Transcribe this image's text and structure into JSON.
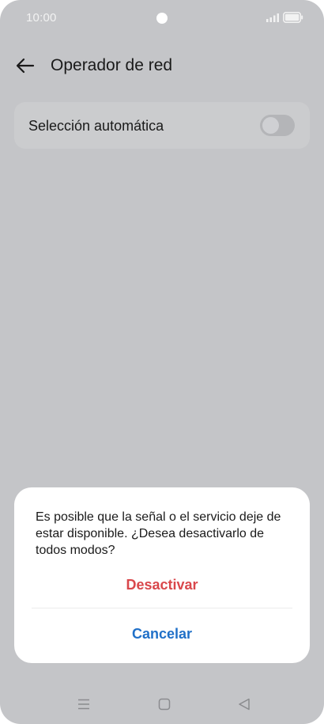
{
  "status_bar": {
    "time": "10:00",
    "icons": [
      "camera-hole",
      "signal-icon",
      "battery-icon"
    ]
  },
  "header": {
    "title": "Operador de red",
    "back_icon": "arrow-left-icon"
  },
  "setting": {
    "label": "Selección automática",
    "toggle_on": false
  },
  "dialog": {
    "message": "Es posible que la señal o el servicio deje de estar disponible. ¿Desea desactivarlo de todos modos?",
    "confirm_label": "Desactivar",
    "cancel_label": "Cancelar"
  },
  "nav_bar": {
    "icons": [
      "menu-icon",
      "home-icon",
      "back-triangle-icon"
    ]
  },
  "colors": {
    "background_dim": "#c4c5c8",
    "confirm": "#d9474b",
    "cancel": "#2070c8"
  }
}
